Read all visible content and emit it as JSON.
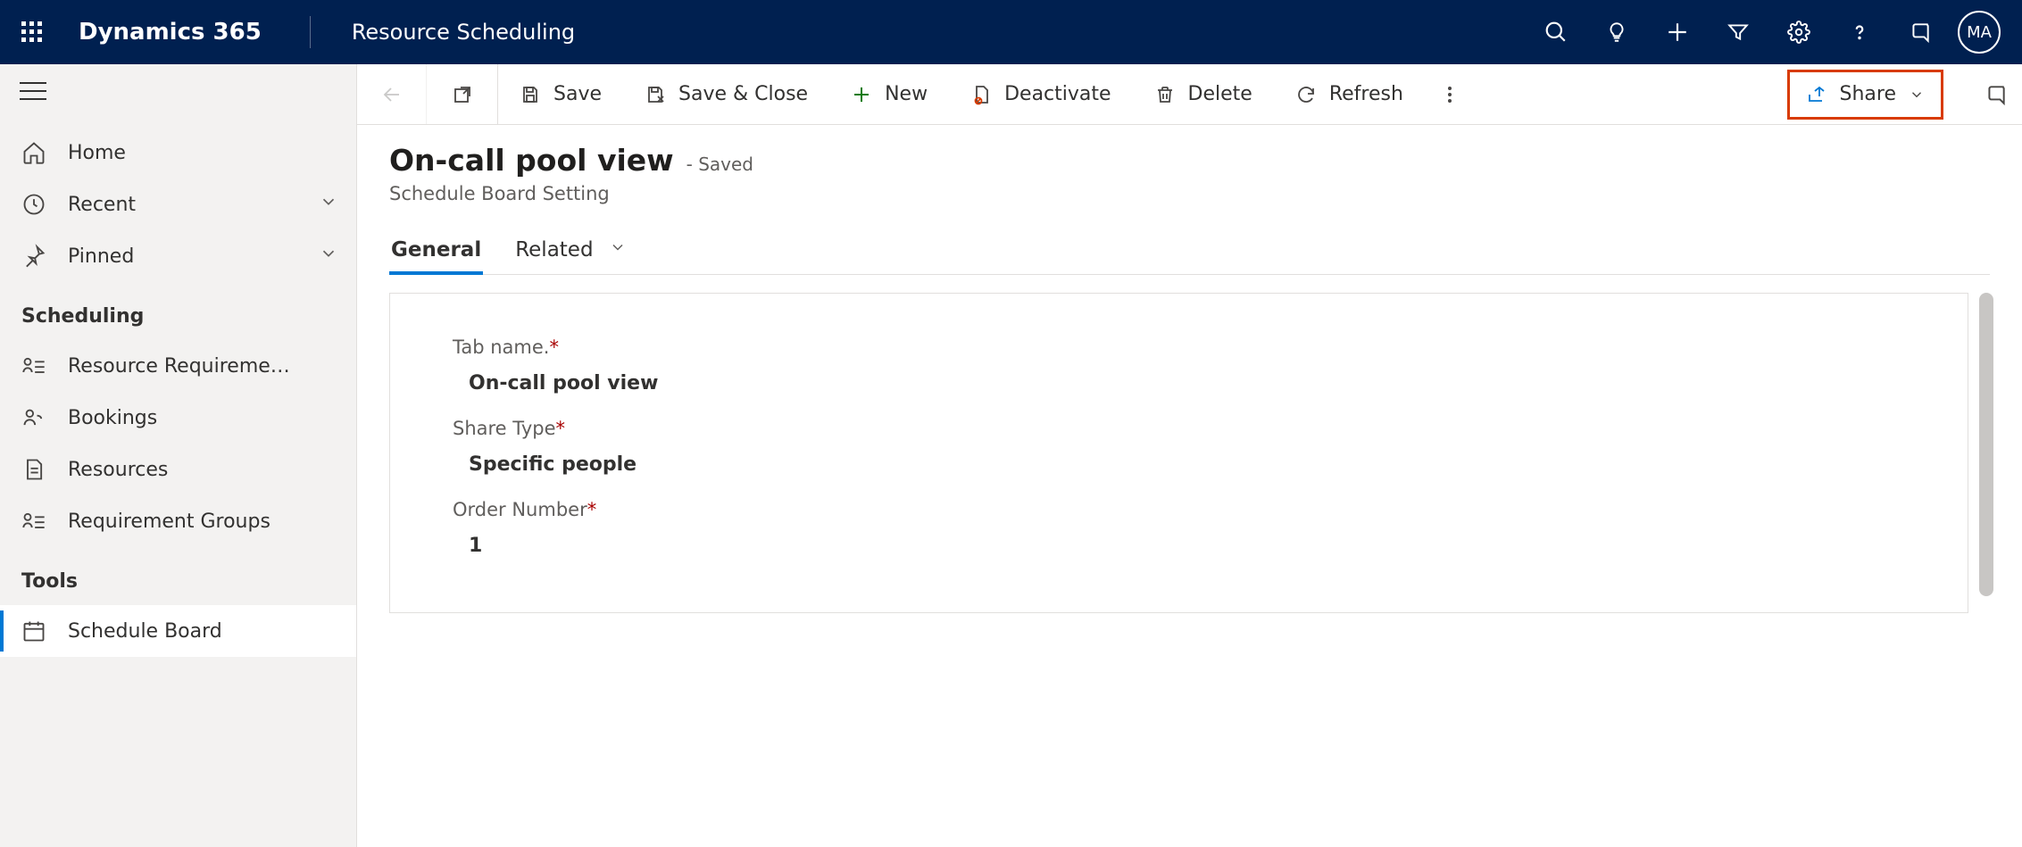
{
  "topnav": {
    "brand": "Dynamics 365",
    "area": "Resource Scheduling",
    "avatar_initials": "MA"
  },
  "sidebar": {
    "items_primary": {
      "home": "Home",
      "recent": "Recent",
      "pinned": "Pinned"
    },
    "group_scheduling": "Scheduling",
    "items_scheduling": {
      "resource_req": "Resource Requireme…",
      "bookings": "Bookings",
      "resources": "Resources",
      "req_groups": "Requirement Groups"
    },
    "group_tools": "Tools",
    "items_tools": {
      "schedule_board": "Schedule Board"
    }
  },
  "commands": {
    "save": "Save",
    "save_close": "Save & Close",
    "new": "New",
    "deactivate": "Deactivate",
    "delete": "Delete",
    "refresh": "Refresh",
    "share": "Share"
  },
  "form": {
    "title": "On-call pool view",
    "state": "- Saved",
    "entity": "Schedule Board Setting",
    "tabs": {
      "general": "General",
      "related": "Related"
    },
    "fields": {
      "tab_name_label": "Tab name.",
      "tab_name_value": "On-call pool view",
      "share_type_label": "Share Type",
      "share_type_value": "Specific people",
      "order_number_label": "Order Number",
      "order_number_value": "1"
    }
  }
}
